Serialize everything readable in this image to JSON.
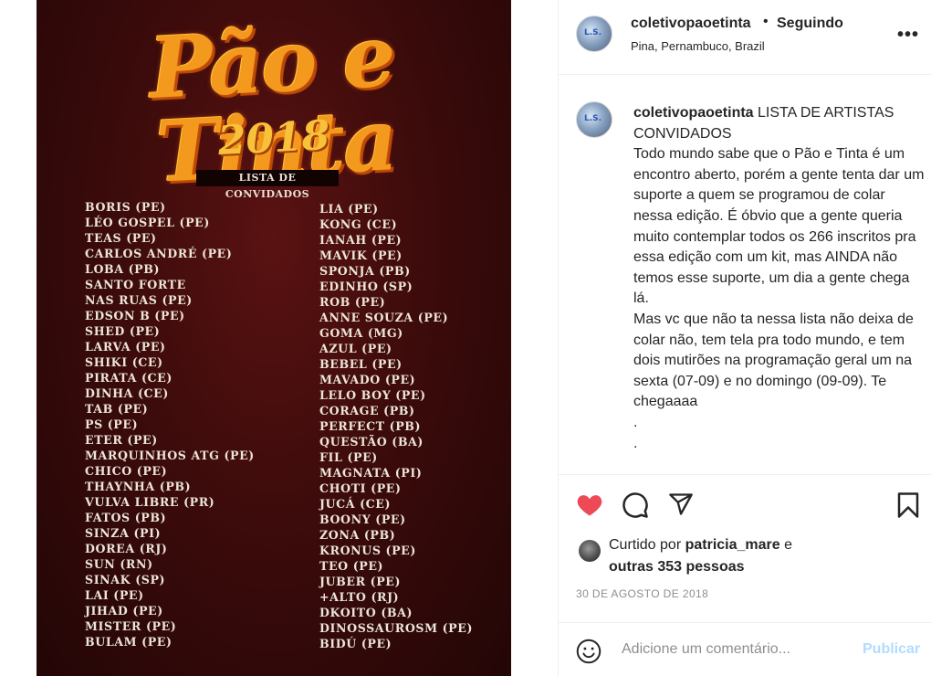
{
  "poster": {
    "title": "Pão e Tinta",
    "year": "2018",
    "subtitle": "LISTA DE CONVIDADOS",
    "column1": [
      "BORIS (PE)",
      "LÉO GOSPEL (PE)",
      "TEAS (PE)",
      "CARLOS ANDRÉ (PE)",
      "LOBA (PB)",
      "SANTO FORTE",
      "NAS RUAS (PE)",
      "EDSON B (PE)",
      "SHED (PE)",
      "LARVA (PE)",
      "SHIKI (CE)",
      "PIRATA (CE)",
      "DINHA (CE)",
      "TAB (PE)",
      "PS (PE)",
      "ETER (PE)",
      "MARQUINHOS ATG (PE)",
      "CHICO (PE)",
      "THAYNHA (PB)",
      "VULVA LIBRE (PR)",
      "FATOS (PB)",
      "SINZA (PI)",
      "DOREA (RJ)",
      "SUN (RN)",
      "SINAK (SP)",
      "LAI (PE)",
      "JIHAD (PE)",
      "MISTER (PE)",
      "BULAM (PE)"
    ],
    "column2": [
      "LIA (PE)",
      "KONG (CE)",
      "IANAH (PE)",
      "MAVIK (PE)",
      "SPONJA (PB)",
      "EDINHO (SP)",
      "ROB (PE)",
      "ANNE SOUZA (PE)",
      "GOMA (MG)",
      "AZUL (PE)",
      "BEBEL (PE)",
      "MAVADO (PE)",
      "LELO BOY (PE)",
      "CORAGE (PB)",
      "PERFECT (PB)",
      "QUESTÃO (BA)",
      "FIL (PE)",
      "MAGNATA (PI)",
      "CHOTI (PE)",
      "JUCÁ (CE)",
      "BOONY (PE)",
      "ZONA (PB)",
      "KRONUS (PE)",
      "TEO (PE)",
      "JUBER (PE)",
      "+ALTO (RJ)",
      "DKOITO (BA)",
      "DINOSSAUROSM (PE)",
      "BIDÚ (PE)"
    ]
  },
  "header": {
    "username": "coletivopaoetinta",
    "separator": "•",
    "follow_status": "Seguindo",
    "location": "Pina, Pernambuco, Brazil",
    "more_icon": "more-horizontal-icon"
  },
  "caption": {
    "username": "coletivopaoetinta",
    "text": " LISTA DE ARTISTAS CONVIDADOS\nTodo mundo sabe que o Pão e Tinta é um encontro aberto, porém a gente tenta dar um suporte a quem se programou de colar nessa edição. É óbvio que a gente queria muito contemplar todos os 266 inscritos pra essa edição com um kit, mas AINDA não temos esse suporte, um dia a gente chega lá.\nMas vc que não ta nessa lista não deixa de colar não, tem tela pra todo mundo, e tem dois mutirões na programação geral um na sexta (07-09) e no domingo (09-09). Te chegaaaa\n.\n."
  },
  "actions": {
    "like_icon": "heart-filled-icon",
    "comment_icon": "comment-bubble-icon",
    "share_icon": "paper-plane-icon",
    "save_icon": "bookmark-icon",
    "like_color": "#ed4956"
  },
  "likes": {
    "prefix": "Curtido por ",
    "user": "patricia_mare",
    "connector": " e",
    "others": "outras 353 pessoas"
  },
  "date": "30 DE AGOSTO DE 2018",
  "comment": {
    "emoji_icon": "smiley-icon",
    "placeholder": "Adicione um comentário...",
    "publish_label": "Publicar",
    "publish_color": "#b3dbff"
  }
}
